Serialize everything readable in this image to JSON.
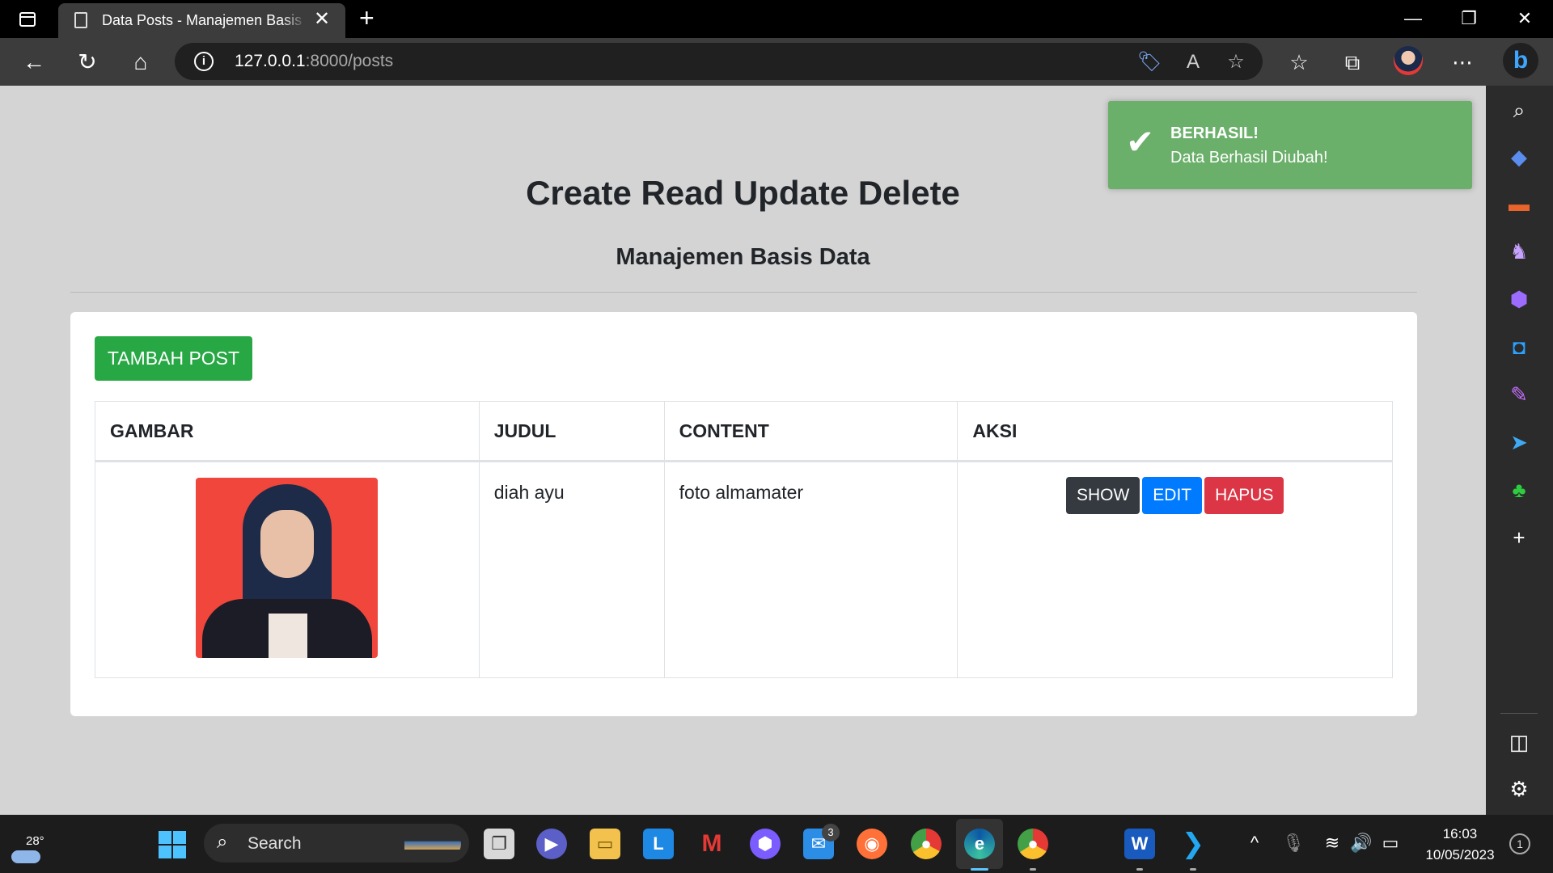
{
  "browser": {
    "tab_title": "Data Posts - Manajemen Basis Data",
    "tab_close": "✕",
    "new_tab": "+",
    "url_host": "127.0.0.1",
    "url_path": ":8000/posts"
  },
  "page": {
    "title": "Create Read Update Delete",
    "subtitle": "Manajemen Basis Data",
    "add_button": "TAMBAH POST",
    "table": {
      "headers": [
        "GAMBAR",
        "JUDUL",
        "CONTENT",
        "AKSI"
      ],
      "rows": [
        {
          "judul": "diah ayu",
          "content": "foto almamater",
          "actions": [
            "SHOW",
            "EDIT",
            "HAPUS"
          ]
        }
      ]
    }
  },
  "toast": {
    "title": "BERHASIL!",
    "message": "Data Berhasil Diubah!"
  },
  "taskbar": {
    "temperature": "28°",
    "search_label": "Search",
    "mail_badge": "3",
    "time": "16:03",
    "date": "10/05/2023",
    "notification_count": "1"
  },
  "colors": {
    "success": "#28a745",
    "primary": "#007bff",
    "danger": "#dc3545",
    "dark": "#343a40",
    "toast_bg": "#6aaf6a"
  },
  "icons": {
    "toolbar": [
      "back-icon",
      "refresh-icon",
      "home-icon",
      "info-icon",
      "coupon-icon",
      "read-aloud-icon",
      "add-favorite-icon",
      "favorites-icon",
      "collections-icon",
      "more-icon",
      "bing-icon"
    ],
    "sidebar": [
      "search-icon",
      "shopping-icon",
      "tools-icon",
      "games-icon",
      "copilot-icon",
      "outlook-icon",
      "designer-icon",
      "drop-icon",
      "tree-icon",
      "add-icon",
      "sidebar-toggle-icon",
      "settings-icon"
    ]
  }
}
